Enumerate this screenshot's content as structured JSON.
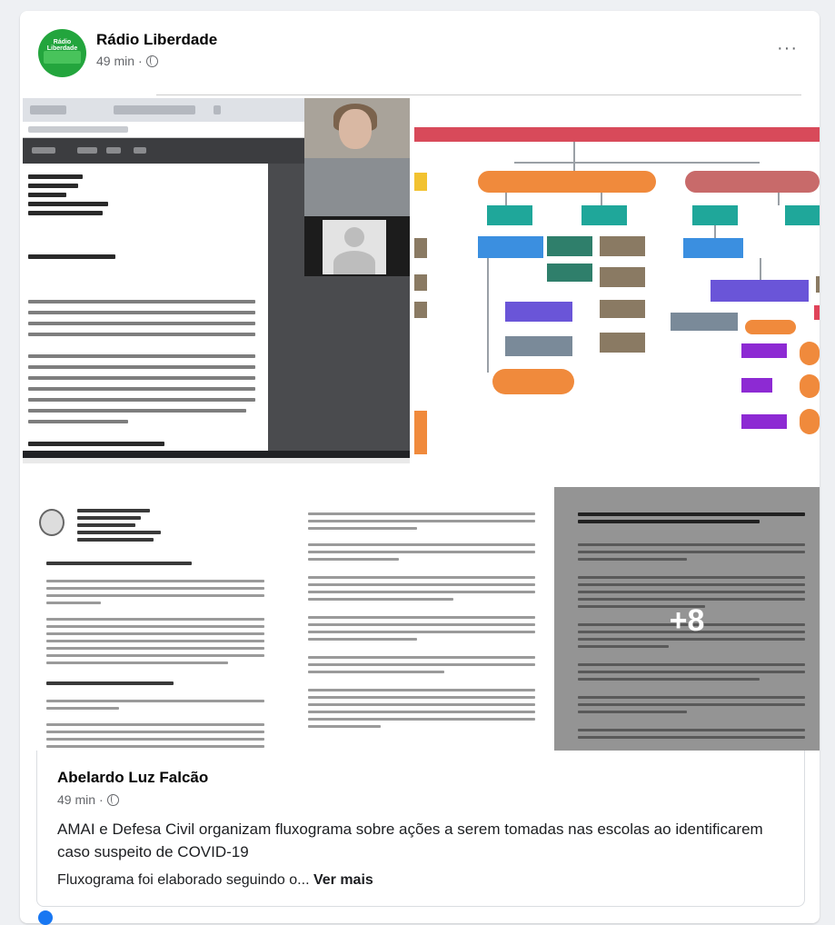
{
  "post": {
    "page_name": "Rádio Liberdade",
    "time": "49 min",
    "separator": "·",
    "more_label": "···",
    "avatar_text": "Rádio Liberdade",
    "icons": {
      "audience": "globe-icon",
      "more": "more-options-icon"
    }
  },
  "gallery": {
    "extra_count": "+8"
  },
  "link_card": {
    "author": "Abelardo Luz Falcão",
    "time": "49 min",
    "separator": "·",
    "title": "AMAI e Defesa Civil organizam fluxograma sobre ações a serem tomadas nas escolas ao identificarem caso suspeito de COVID-19",
    "snippet": "Fluxograma foi elaborado seguindo o...",
    "see_more": "Ver mais"
  },
  "colors": {
    "brand_green": "#23a53d",
    "muted_text": "#65676b",
    "flow_header": "#d84a5a",
    "flow_orange": "#f08a3c"
  }
}
